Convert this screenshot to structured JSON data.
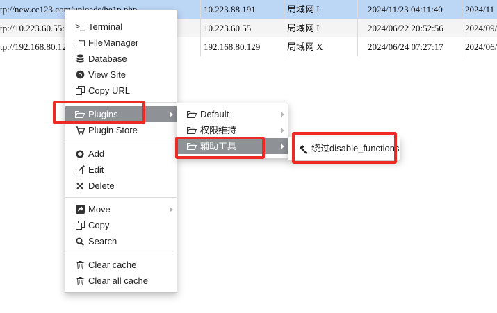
{
  "table": {
    "rows": [
      {
        "url": "tp://new.cc123.com/uploads/he1p.php",
        "ip": "10.223.88.191",
        "location": "局域网 I",
        "created": "2024/11/23 04:11:40",
        "updated": "2024/11",
        "selected": true
      },
      {
        "url": "tp://10.223.60.55:8",
        "ip": "10.223.60.55",
        "location": "局域网 I",
        "created": "2024/06/22 20:52:56",
        "updated": "2024/09/",
        "selected": false
      },
      {
        "url": "tp://192.168.80.12",
        "ip": "192.168.80.129",
        "location": "局域网 X",
        "created": "2024/06/24 07:27:17",
        "updated": "2024/06/",
        "selected": false
      }
    ]
  },
  "context_menu": {
    "terminal": "Terminal",
    "file_manager": "FileManager",
    "database": "Database",
    "view_site": "View Site",
    "copy_url": "Copy URL",
    "plugins": "Plugins",
    "plugin_store": "Plugin Store",
    "add": "Add",
    "edit": "Edit",
    "delete": "Delete",
    "move": "Move",
    "copy": "Copy",
    "search": "Search",
    "clear_cache": "Clear cache",
    "clear_all_cache": "Clear all cache"
  },
  "plugins_menu": {
    "default": "Default",
    "privilege_maintain": "权限维持",
    "aux_tools": "辅助工具"
  },
  "tools_menu": {
    "bypass_disable_functions": "绕过disable_functions"
  },
  "colors": {
    "selected_row": "#bcd6f6",
    "active_item": "#8e9297",
    "highlight_box": "#ee2a24"
  }
}
